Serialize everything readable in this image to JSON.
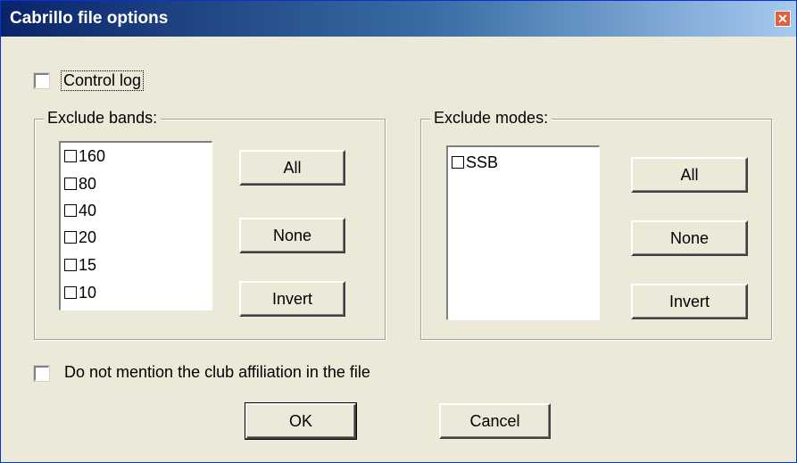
{
  "window": {
    "title": "Cabrillo file options",
    "close_glyph": "✕"
  },
  "control_log": {
    "label": "Control log",
    "checked": false
  },
  "exclude_bands": {
    "title": "Exclude bands:",
    "items": [
      {
        "label": "160",
        "checked": false
      },
      {
        "label": "80",
        "checked": false
      },
      {
        "label": "40",
        "checked": false
      },
      {
        "label": "20",
        "checked": false
      },
      {
        "label": "15",
        "checked": false
      },
      {
        "label": "10",
        "checked": false
      }
    ],
    "buttons": {
      "all": "All",
      "none": "None",
      "invert": "Invert"
    }
  },
  "exclude_modes": {
    "title": "Exclude modes:",
    "items": [
      {
        "label": "SSB",
        "checked": false
      }
    ],
    "buttons": {
      "all": "All",
      "none": "None",
      "invert": "Invert"
    }
  },
  "club_affiliation": {
    "label": "Do not mention the club affiliation in the file",
    "checked": false
  },
  "footer": {
    "ok": "OK",
    "cancel": "Cancel"
  }
}
